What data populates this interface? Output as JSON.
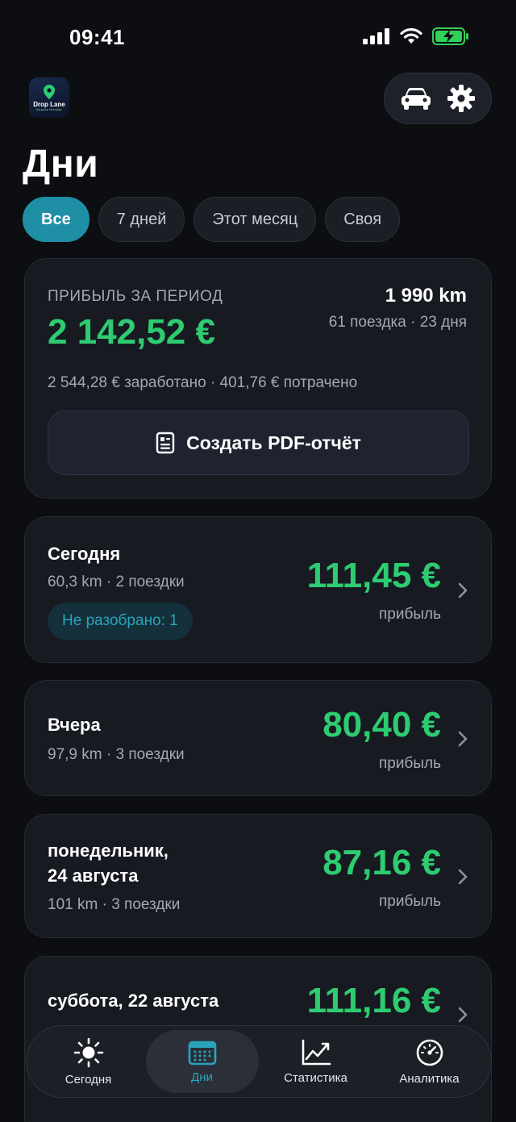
{
  "status": {
    "time": "09:41"
  },
  "app": {
    "logo_text": "Drop Lane",
    "logo_sub": "MILEAGE TRACKER"
  },
  "header": {
    "title": "Дни"
  },
  "filters": [
    "Все",
    "7 дней",
    "Этот месяц",
    "Своя"
  ],
  "summary": {
    "label": "ПРИБЫЛЬ ЗА ПЕРИОД",
    "profit": "2 142,52 €",
    "km": "1 990 km",
    "trips_days": "61 поездка · 23 дня",
    "detail": "2 544,28 € заработано · 401,76 € потрачено",
    "pdf_button": "Создать PDF-отчёт"
  },
  "days": [
    {
      "title": "Сегодня",
      "meta": "60,3 km · 2 поездки",
      "profit": "111,45 €",
      "profit_label": "прибыль",
      "badge": "Не разобрано: 1"
    },
    {
      "title": "Вчера",
      "meta": "97,9 km · 3 поездки",
      "profit": "80,40 €",
      "profit_label": "прибыль"
    },
    {
      "title": "понедельник,\n24 августа",
      "meta": "101 km · 3 поездки",
      "profit": "87,16 €",
      "profit_label": "прибыль"
    },
    {
      "title": "суббота, 22 августа",
      "profit": "111,16 €"
    }
  ],
  "tabbar": [
    {
      "label": "Сегодня",
      "icon": "sun-icon"
    },
    {
      "label": "Дни",
      "icon": "calendar-icon",
      "active": true
    },
    {
      "label": "Статистика",
      "icon": "chart-icon"
    },
    {
      "label": "Аналитика",
      "icon": "gauge-icon"
    }
  ],
  "colors": {
    "accent": "#1f8fa6",
    "profit": "#2ecc71",
    "background": "#0d0e12",
    "card": "#171a21"
  }
}
